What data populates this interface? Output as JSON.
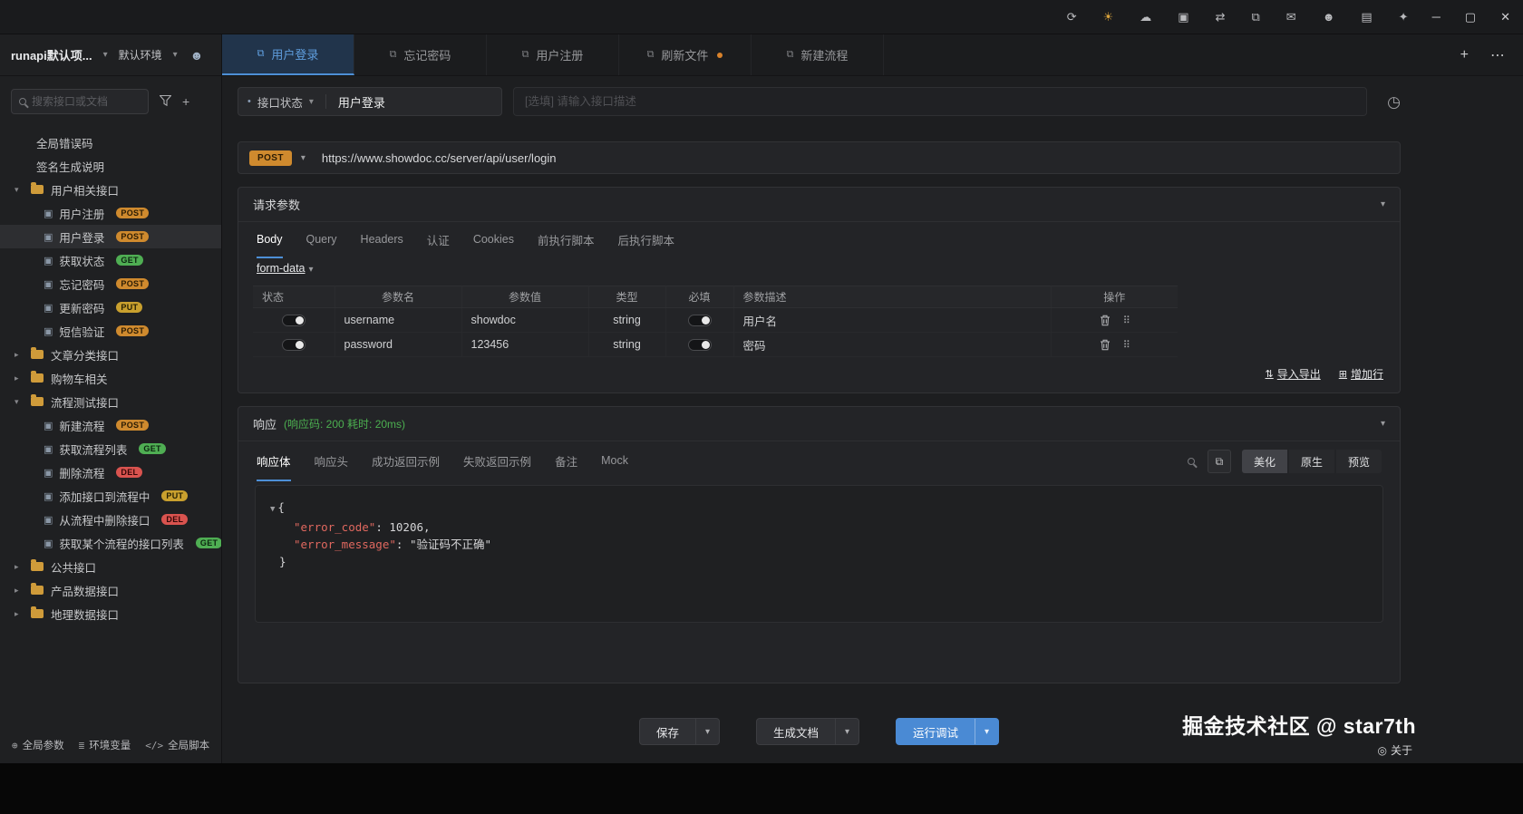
{
  "colors": {
    "accent_blue": "#4d8fd6",
    "method_post": "#cf8a2e",
    "method_get": "#4fae53",
    "method_put": "#c9a02e",
    "method_del": "#d9534f",
    "response_ok_green": "#4caf50",
    "json_key_red": "#e0685f",
    "unsaved_dot_orange": "#d9822b"
  },
  "icons": {
    "refresh": "⟳",
    "theme": "☀",
    "cloud": "☁",
    "storage": "▣",
    "sync": "⇄",
    "display": "⧉",
    "mail": "✉",
    "account": "☻",
    "book": "▤",
    "pin": "✦",
    "minimize": "─",
    "maximize": "▢",
    "close": "✕",
    "chevron_down": "▾",
    "chevron_right": "▸",
    "plus": "+",
    "more": "⋯",
    "team": "☻",
    "tab_doc": "⧉",
    "doc": "▣",
    "clock": "◷",
    "bullet": "•",
    "copy": "⧉",
    "drag": "⠿",
    "import_export": "⇅",
    "add_row": "⊞",
    "globe": "⊕",
    "env": "≣",
    "script": "</>",
    "collapse_caret": "▼",
    "about": "◎"
  },
  "topbar": {
    "project_name": "runapi默认项...",
    "environment": "默认环境",
    "tabs": [
      {
        "label": "用户登录"
      },
      {
        "label": "忘记密码"
      },
      {
        "label": "用户注册"
      },
      {
        "label": "刷新文件"
      },
      {
        "label": "新建流程"
      }
    ]
  },
  "sidebar": {
    "search_placeholder": "搜索接口或文档",
    "items": [
      {
        "label": "全局错误码"
      },
      {
        "label": "签名生成说明"
      },
      {
        "label": "用户相关接口"
      },
      {
        "label": "用户注册",
        "badge": "POST"
      },
      {
        "label": "用户登录",
        "badge": "POST"
      },
      {
        "label": "获取状态",
        "badge": "GET"
      },
      {
        "label": "忘记密码",
        "badge": "POST"
      },
      {
        "label": "更新密码",
        "badge": "PUT"
      },
      {
        "label": "短信验证",
        "badge": "POST"
      },
      {
        "label": "文章分类接口"
      },
      {
        "label": "购物车相关"
      },
      {
        "label": "流程测试接口"
      },
      {
        "label": "新建流程",
        "badge": "POST"
      },
      {
        "label": "获取流程列表",
        "badge": "GET"
      },
      {
        "label": "删除流程",
        "badge": "DEL"
      },
      {
        "label": "添加接口到流程中",
        "badge": "PUT"
      },
      {
        "label": "从流程中删除接口",
        "badge": "DEL"
      },
      {
        "label": "获取某个流程的接口列表",
        "badge": "GET"
      },
      {
        "label": "公共接口"
      },
      {
        "label": "产品数据接口"
      },
      {
        "label": "地理数据接口"
      }
    ],
    "footer": [
      {
        "label": "全局参数"
      },
      {
        "label": "环境变量"
      },
      {
        "label": "全局脚本"
      }
    ]
  },
  "main": {
    "meta": {
      "status_label": "接口状态",
      "title": "用户登录",
      "description_placeholder": "[选填] 请输入接口描述"
    },
    "request": {
      "method": "POST",
      "url": "https://www.showdoc.cc/server/api/user/login",
      "section_title": "请求参数",
      "tabs": [
        "Body",
        "Query",
        "Headers",
        "认证",
        "Cookies",
        "前执行脚本",
        "后执行脚本"
      ],
      "body_type": "form-data",
      "table": {
        "headers": [
          "状态",
          "参数名",
          "参数值",
          "类型",
          "必填",
          "参数描述",
          "操作"
        ],
        "rows": [
          {
            "name": "username",
            "value": "showdoc",
            "type": "string",
            "desc": "用户名"
          },
          {
            "name": "password",
            "value": "123456",
            "type": "string",
            "desc": "密码"
          }
        ]
      },
      "import_export": "导入导出",
      "add_row": "增加行"
    },
    "response": {
      "section_title": "响应",
      "status_info": "(响应码: 200 耗时: 20ms)",
      "tabs": [
        "响应体",
        "响应头",
        "成功返回示例",
        "失败返回示例",
        "备注",
        "Mock"
      ],
      "view_modes": [
        "美化",
        "原生",
        "预览"
      ],
      "body": {
        "open": "{",
        "key1": "\"error_code\"",
        "sep1": ": ",
        "num1": "10206",
        "comma1": ",",
        "key2": "\"error_message\"",
        "sep2": ": ",
        "str2": "\"验证码不正确\"",
        "close": "}"
      }
    },
    "actions": [
      {
        "label": "保存"
      },
      {
        "label": "生成文档"
      },
      {
        "label": "运行调试"
      }
    ]
  },
  "footer": {
    "watermark": "掘金技术社区 @ star7th",
    "about": "关于"
  }
}
